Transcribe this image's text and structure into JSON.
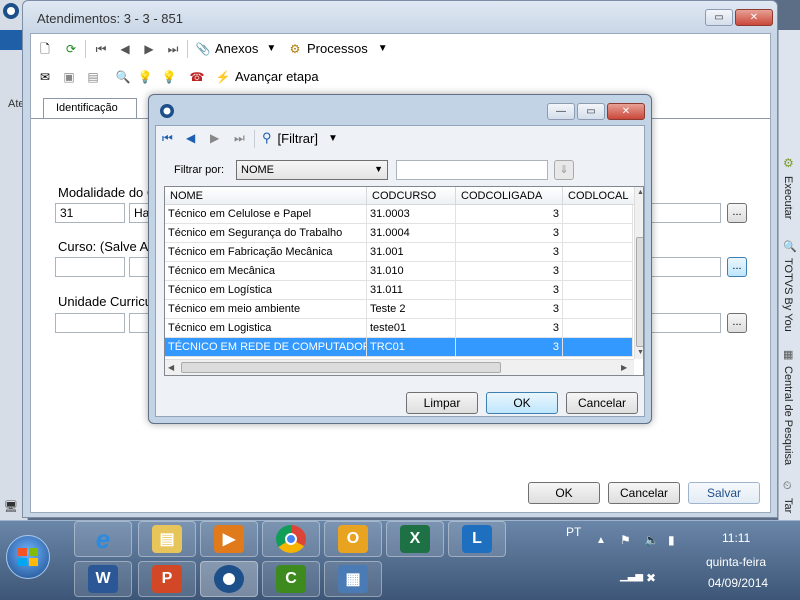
{
  "background_app": {
    "label": "Ate"
  },
  "main_window": {
    "title": "Atendimentos: 3 - 3 - 851",
    "toolbar1": {
      "anexos": "Anexos",
      "processos": "Processos"
    },
    "toolbar2": {
      "avancar": "Avançar etapa"
    },
    "tab": "Identificação",
    "fields": {
      "modalidade_label": "Modalidade do C",
      "modalidade_code": "31",
      "modalidade_desc": "Hab",
      "curso_label": "Curso: (Salve Ant",
      "unidade_label": "Unidade Curricul"
    },
    "buttons": {
      "ok": "OK",
      "cancel": "Cancelar",
      "save": "Salvar"
    }
  },
  "side_panel": {
    "items": [
      "Executar",
      "TOTVS By You",
      "Central de Pesquisa",
      "Tar"
    ]
  },
  "dialog": {
    "toolbar": {
      "filter": "[Filtrar]"
    },
    "filter_label": "Filtrar por:",
    "filter_select": "NOME",
    "filter_value": "",
    "columns": [
      "NOME",
      "CODCURSO",
      "CODCOLIGADA",
      "CODLOCAL"
    ],
    "rows": [
      [
        "Técnico em Celulose e Papel",
        "31.0003",
        "3",
        ""
      ],
      [
        "Técnico em Segurança do Trabalho",
        "31.0004",
        "3",
        ""
      ],
      [
        "Técnico em Fabricação Mecânica",
        "31.001",
        "3",
        ""
      ],
      [
        "Técnico em Mecânica",
        "31.010",
        "3",
        ""
      ],
      [
        "Técnico em Logística",
        "31.011",
        "3",
        ""
      ],
      [
        "Técnico em meio ambiente",
        "Teste 2",
        "3",
        ""
      ],
      [
        "Técnico em Logistica",
        "teste01",
        "3",
        ""
      ],
      [
        "TÉCNICO EM REDE DE COMPUTADORES",
        "TRC01",
        "3",
        ""
      ]
    ],
    "selected_row": 7,
    "buttons": {
      "clear": "Limpar",
      "ok": "OK",
      "cancel": "Cancelar"
    }
  },
  "taskbar": {
    "lang": "PT",
    "time": "11:11",
    "day": "quinta-feira",
    "date": "04/09/2014"
  }
}
